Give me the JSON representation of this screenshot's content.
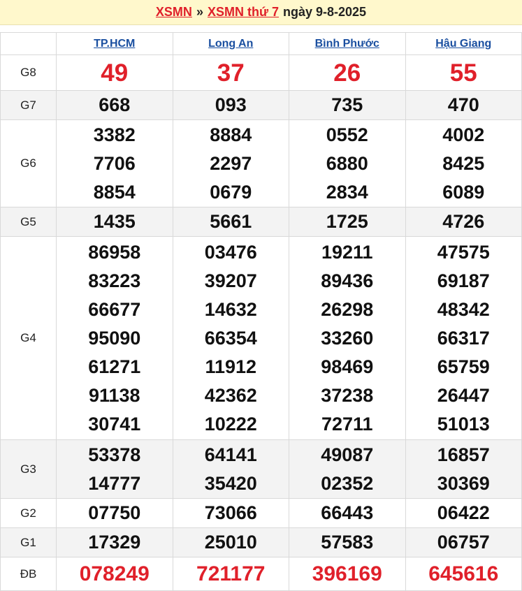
{
  "header": {
    "link1": "XSMN",
    "separator": "»",
    "link2": "XSMN thứ 7",
    "date_text": "ngày 9-8-2025"
  },
  "provinces": [
    "TP.HCM",
    "Long An",
    "Bình Phước",
    "Hậu Giang"
  ],
  "prizes": {
    "g8": {
      "label": "G8",
      "values": [
        "49",
        "37",
        "26",
        "55"
      ]
    },
    "g7": {
      "label": "G7",
      "values": [
        "668",
        "093",
        "735",
        "470"
      ]
    },
    "g6": {
      "label": "G6",
      "values": [
        [
          "3382",
          "7706",
          "8854"
        ],
        [
          "8884",
          "2297",
          "0679"
        ],
        [
          "0552",
          "6880",
          "2834"
        ],
        [
          "4002",
          "8425",
          "6089"
        ]
      ]
    },
    "g5": {
      "label": "G5",
      "values": [
        "1435",
        "5661",
        "1725",
        "4726"
      ]
    },
    "g4": {
      "label": "G4",
      "values": [
        [
          "86958",
          "83223",
          "66677",
          "95090",
          "61271",
          "91138",
          "30741"
        ],
        [
          "03476",
          "39207",
          "14632",
          "66354",
          "11912",
          "42362",
          "10222"
        ],
        [
          "19211",
          "89436",
          "26298",
          "33260",
          "98469",
          "37238",
          "72711"
        ],
        [
          "47575",
          "69187",
          "48342",
          "66317",
          "65759",
          "26447",
          "51013"
        ]
      ]
    },
    "g3": {
      "label": "G3",
      "values": [
        [
          "53378",
          "14777"
        ],
        [
          "64141",
          "35420"
        ],
        [
          "49087",
          "02352"
        ],
        [
          "16857",
          "30369"
        ]
      ]
    },
    "g2": {
      "label": "G2",
      "values": [
        "07750",
        "73066",
        "66443",
        "06422"
      ]
    },
    "g1": {
      "label": "G1",
      "values": [
        "17329",
        "25010",
        "57583",
        "06757"
      ]
    },
    "db": {
      "label": "ĐB",
      "values": [
        "078249",
        "721177",
        "396169",
        "645616"
      ]
    }
  },
  "colors": {
    "accent_red": "#e0202a",
    "link_blue": "#1a4fa0",
    "header_bg": "#fff8cc"
  }
}
